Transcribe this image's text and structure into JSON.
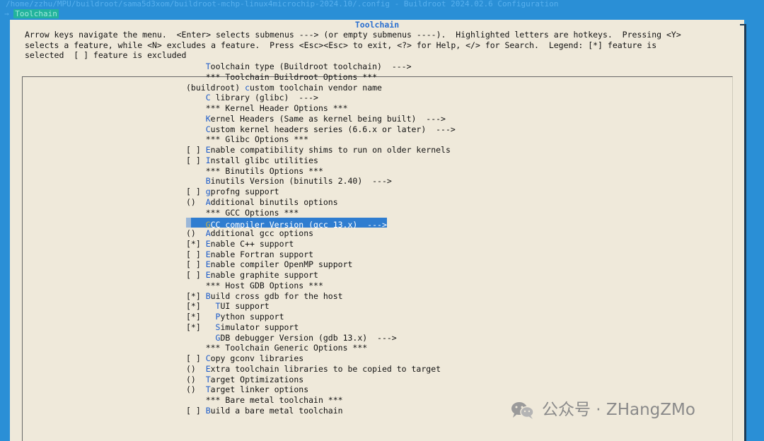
{
  "window": {
    "title": "/home/zzhu/MPU/buildroot/sama5d3xom/buildroot-mchp-linux4microchip-2024.10/.config - Buildroot 2024.02.6 Configuration",
    "breadcrumb_prefix": "→ ",
    "breadcrumb_item": "Toolchain"
  },
  "dialog": {
    "title": "Toolchain",
    "help_lines": [
      "Arrow keys navigate the menu.  <Enter> selects submenus ---> (or empty submenus ----).  Highlighted letters are hotkeys.  Pressing <Y>",
      "selects a feature, while <N> excludes a feature.  Press <Esc><Esc> to exit, <?> for Help, </> for Search.  Legend: [*] feature is",
      "selected  [ ] feature is excluded"
    ]
  },
  "menu": {
    "items": [
      {
        "prefix": "    ",
        "hotkey": "T",
        "rest": "oolchain type (Buildroot toolchain)  --->"
      },
      {
        "prefix": "    ",
        "hotkey": "",
        "rest": "*** Toolchain Buildroot Options ***"
      },
      {
        "prefix": "(buildroot) ",
        "hotkey": "c",
        "rest": "ustom toolchain vendor name"
      },
      {
        "prefix": "    ",
        "hotkey": "C",
        "rest": " library (glibc)  --->"
      },
      {
        "prefix": "    ",
        "hotkey": "",
        "rest": "*** Kernel Header Options ***"
      },
      {
        "prefix": "    ",
        "hotkey": "K",
        "rest": "ernel Headers (Same as kernel being built)  --->"
      },
      {
        "prefix": "    ",
        "hotkey": "C",
        "rest": "ustom kernel headers series (6.6.x or later)  --->"
      },
      {
        "prefix": "    ",
        "hotkey": "",
        "rest": "*** Glibc Options ***"
      },
      {
        "prefix": "[ ] ",
        "hotkey": "E",
        "rest": "nable compatibility shims to run on older kernels"
      },
      {
        "prefix": "[ ] ",
        "hotkey": "I",
        "rest": "nstall glibc utilities"
      },
      {
        "prefix": "    ",
        "hotkey": "",
        "rest": "*** Binutils Options ***"
      },
      {
        "prefix": "    ",
        "hotkey": "B",
        "rest": "inutils Version (binutils 2.40)  --->"
      },
      {
        "prefix": "[ ] ",
        "hotkey": "g",
        "rest": "profng support"
      },
      {
        "prefix": "()  ",
        "hotkey": "A",
        "rest": "dditional binutils options"
      },
      {
        "prefix": "    ",
        "hotkey": "",
        "rest": "*** GCC Options ***"
      },
      {
        "prefix": "    ",
        "hotkey": "G",
        "rest": "CC compiler Version (gcc 13.x)  --->",
        "selected": true
      },
      {
        "prefix": "()  ",
        "hotkey": "A",
        "rest": "dditional gcc options"
      },
      {
        "prefix": "[*] ",
        "hotkey": "E",
        "rest": "nable C++ support"
      },
      {
        "prefix": "[ ] ",
        "hotkey": "E",
        "rest": "nable Fortran support"
      },
      {
        "prefix": "[ ] ",
        "hotkey": "E",
        "rest": "nable compiler OpenMP support"
      },
      {
        "prefix": "[ ] ",
        "hotkey": "E",
        "rest": "nable graphite support"
      },
      {
        "prefix": "    ",
        "hotkey": "",
        "rest": "*** Host GDB Options ***"
      },
      {
        "prefix": "[*] ",
        "hotkey": "B",
        "rest": "uild cross gdb for the host"
      },
      {
        "prefix": "[*]   ",
        "hotkey": "T",
        "rest": "UI support"
      },
      {
        "prefix": "[*]   ",
        "hotkey": "P",
        "rest": "ython support"
      },
      {
        "prefix": "[*]   ",
        "hotkey": "S",
        "rest": "imulator support"
      },
      {
        "prefix": "      ",
        "hotkey": "G",
        "rest": "DB debugger Version (gdb 13.x)  --->"
      },
      {
        "prefix": "    ",
        "hotkey": "",
        "rest": "*** Toolchain Generic Options ***"
      },
      {
        "prefix": "[ ] ",
        "hotkey": "C",
        "rest": "opy gconv libraries"
      },
      {
        "prefix": "()  ",
        "hotkey": "E",
        "rest": "xtra toolchain libraries to be copied to target"
      },
      {
        "prefix": "()  ",
        "hotkey": "T",
        "rest": "arget Optimizations"
      },
      {
        "prefix": "()  ",
        "hotkey": "T",
        "rest": "arget linker options"
      },
      {
        "prefix": "    ",
        "hotkey": "",
        "rest": "*** Bare metal toolchain ***"
      },
      {
        "prefix": "[ ] ",
        "hotkey": "B",
        "rest": "uild a bare metal toolchain"
      }
    ]
  },
  "watermark": {
    "icon": "wechat-icon",
    "text": "公众号 · ZHangZMo"
  },
  "colors": {
    "background": "#2a8fd6",
    "dialog": "#efe9da",
    "title": "#2a6fd0",
    "hotkey": "#1c5bc9",
    "selection": "#2f7dd0"
  }
}
